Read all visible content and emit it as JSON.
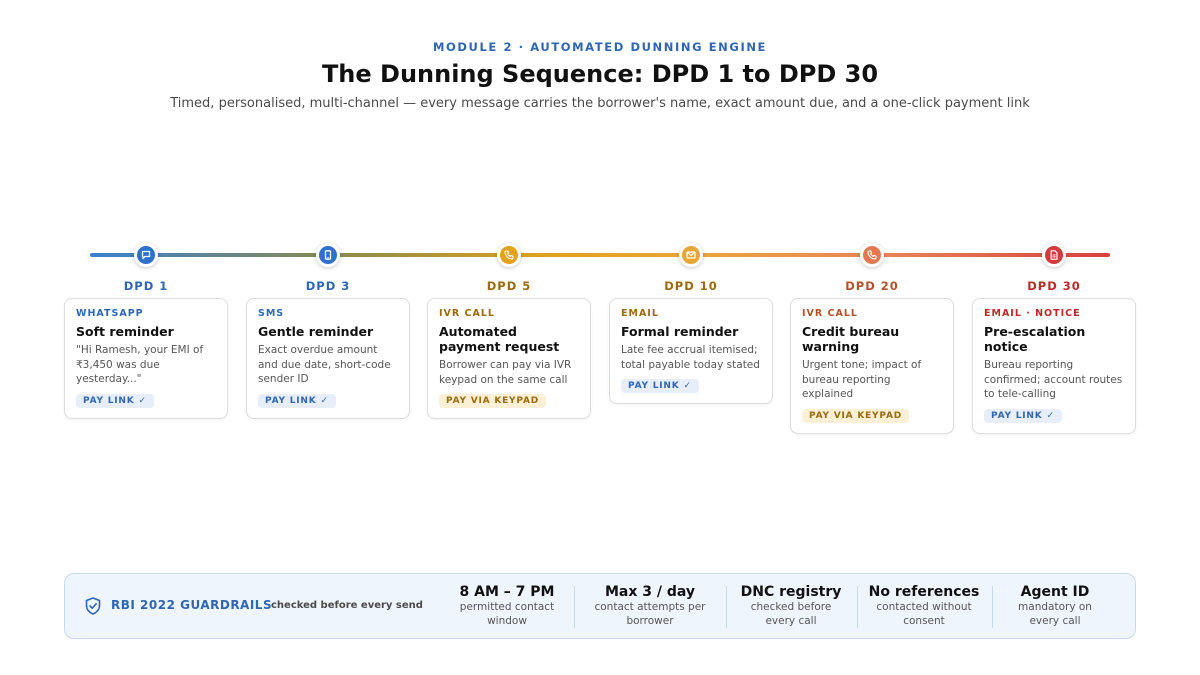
{
  "header": {
    "eyebrow": "MODULE 2 · AUTOMATED DUNNING ENGINE",
    "title": "The Dunning Sequence: DPD 1 to DPD 30",
    "subtitle": "Timed, personalised, multi-channel — every message carries the borrower's name, exact amount due, and a one-click payment link"
  },
  "steps": [
    {
      "dpd": "DPD 1",
      "channel": "WHATSAPP",
      "title": "Soft reminder",
      "desc": "\"Hi Ramesh, your EMI of ₹3,450 was due yesterday...\"",
      "tag": "PAY LINK ✓",
      "tag_type": "pay",
      "icon": "chat-bubble-icon",
      "color": "#2f66b3",
      "node_color": "#2f6fce"
    },
    {
      "dpd": "DPD 3",
      "channel": "SMS",
      "title": "Gentle reminder",
      "desc": "Exact overdue amount and due date, short-code sender ID",
      "tag": "PAY LINK ✓",
      "tag_type": "pay",
      "icon": "mobile-phone-icon",
      "color": "#2f66b3",
      "node_color": "#2f6fce"
    },
    {
      "dpd": "DPD 5",
      "channel": "IVR CALL",
      "title": "Automated payment request",
      "desc": "Borrower can pay via IVR keypad on the same call",
      "tag": "PAY VIA KEYPAD",
      "tag_type": "keypad",
      "icon": "phone-icon",
      "color": "#9a6a0b",
      "node_color": "#e3a21a"
    },
    {
      "dpd": "DPD 10",
      "channel": "EMAIL",
      "title": "Formal reminder",
      "desc": "Late fee accrual itemised; total payable today stated",
      "tag": "PAY LINK ✓",
      "tag_type": "pay",
      "icon": "envelope-icon",
      "color": "#9a6a0b",
      "node_color": "#e8a735"
    },
    {
      "dpd": "DPD 20",
      "channel": "IVR CALL",
      "title": "Credit bureau warning",
      "desc": "Urgent tone; impact of bureau reporting explained",
      "tag": "PAY VIA KEYPAD",
      "tag_type": "keypad",
      "icon": "phone-icon",
      "color": "#b5502a",
      "node_color": "#e67851"
    },
    {
      "dpd": "DPD 30",
      "channel": "EMAIL · NOTICE",
      "title": "Pre-escalation notice",
      "desc": "Bureau reporting confirmed; account routes to tele-calling",
      "tag": "PAY LINK ✓",
      "tag_type": "pay",
      "icon": "document-icon",
      "color": "#b92a28",
      "node_color": "#d23b39"
    }
  ],
  "guardrails": {
    "title": "RBI 2022 GUARDRAILS",
    "note": "checked before every send",
    "icon": "shield-check-icon",
    "stats": [
      {
        "big": "8 AM – 7 PM",
        "small1": "permitted contact",
        "small2": "window"
      },
      {
        "big": "Max 3 / day",
        "small1": "contact attempts per",
        "small2": "borrower"
      },
      {
        "big": "DNC registry",
        "small1": "checked before",
        "small2": "every call"
      },
      {
        "big": "No references",
        "small1": "contacted without",
        "small2": "consent"
      },
      {
        "big": "Agent ID",
        "small1": "mandatory on",
        "small2": "every call"
      }
    ]
  }
}
